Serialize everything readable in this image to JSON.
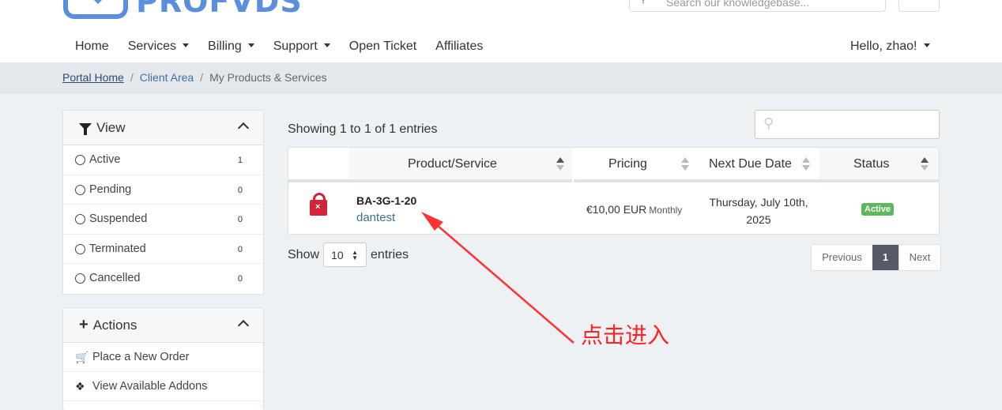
{
  "brand": {
    "name": "PROFVDS",
    "color": "#5a8fde"
  },
  "search": {
    "placeholder": "Search our knowledgebase..."
  },
  "nav": {
    "items": [
      {
        "label": "Home",
        "dropdown": false
      },
      {
        "label": "Services",
        "dropdown": true
      },
      {
        "label": "Billing",
        "dropdown": true
      },
      {
        "label": "Support",
        "dropdown": true
      },
      {
        "label": "Open Ticket",
        "dropdown": false
      },
      {
        "label": "Affiliates",
        "dropdown": false
      }
    ],
    "user": "Hello, zhao!"
  },
  "breadcrumb": {
    "home": "Portal Home",
    "client": "Client Area",
    "current": "My Products & Services",
    "sep": "/"
  },
  "view_panel": {
    "title": "View",
    "items": [
      {
        "label": "Active",
        "count": "1"
      },
      {
        "label": "Pending",
        "count": "0"
      },
      {
        "label": "Suspended",
        "count": "0"
      },
      {
        "label": "Terminated",
        "count": "0"
      },
      {
        "label": "Cancelled",
        "count": "0"
      }
    ]
  },
  "actions_panel": {
    "title": "Actions",
    "items": [
      {
        "label": "Place a New Order",
        "icon": "cart-icon"
      },
      {
        "label": "View Available Addons",
        "icon": "cubes-icon"
      }
    ]
  },
  "table": {
    "showing": "Showing 1 to 1 of 1 entries",
    "columns": [
      "Product/Service",
      "Pricing",
      "Next Due Date",
      "Status"
    ],
    "rows": [
      {
        "product": "BA-3G-1-20",
        "hostname": "dantest",
        "price": "€10,00 EUR",
        "cycle": "Monthly",
        "due_line1": "Thursday, July 10th,",
        "due_line2": "2025",
        "status": "Active",
        "status_color": "#5cb85c"
      }
    ]
  },
  "entries": {
    "show": "Show",
    "value": "10",
    "entries": "entries"
  },
  "pagination": {
    "previous": "Previous",
    "current": "1",
    "next": "Next"
  },
  "annotation": {
    "text": "点击进入",
    "color": "#ff2222"
  }
}
